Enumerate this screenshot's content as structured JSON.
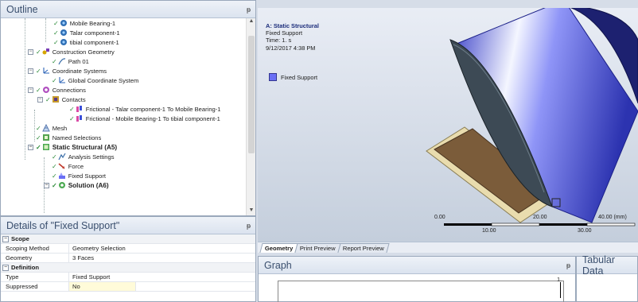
{
  "outline": {
    "title": "Outline",
    "pin": "ᵽ",
    "items": [
      {
        "label": "Mobile Bearing-1"
      },
      {
        "label": "Talar component-1"
      },
      {
        "label": "tibial component-1"
      },
      {
        "label": "Construction Geometry"
      },
      {
        "label": "Path 01"
      },
      {
        "label": "Coordinate Systems"
      },
      {
        "label": "Global Coordinate System"
      },
      {
        "label": "Connections"
      },
      {
        "label": "Contacts"
      },
      {
        "label": "Frictional - Talar component-1 To Mobile Bearing-1"
      },
      {
        "label": "Frictional - Mobile Bearing-1 To tibial component-1"
      },
      {
        "label": "Mesh"
      },
      {
        "label": "Named Selections"
      },
      {
        "label": "Static Structural (A5)"
      },
      {
        "label": "Analysis Settings"
      },
      {
        "label": "Force"
      },
      {
        "label": "Fixed Support"
      },
      {
        "label": "Solution (A6)"
      }
    ]
  },
  "details": {
    "title": "Details of \"Fixed Support\"",
    "pin": "ᵽ",
    "groups": [
      {
        "name": "Scope",
        "rows": [
          {
            "key": "Scoping Method",
            "value": "Geometry Selection"
          },
          {
            "key": "Geometry",
            "value": "3 Faces"
          }
        ]
      },
      {
        "name": "Definition",
        "rows": [
          {
            "key": "Type",
            "value": "Fixed Support"
          },
          {
            "key": "Suppressed",
            "value": "No"
          }
        ]
      }
    ]
  },
  "viewport": {
    "info_title": "A: Static Structural",
    "info_lines": [
      "Fixed Support",
      "Time: 1. s",
      "9/12/2017 4:38 PM"
    ],
    "legend_label": "Fixed Support",
    "scale": {
      "top_labels": [
        "0.00",
        "20.00",
        "40.00 (mm)"
      ],
      "bottom_labels": [
        "10.00",
        "30.00"
      ]
    }
  },
  "tabs": [
    "Geometry",
    "Print Preview",
    "Report Preview"
  ],
  "graph": {
    "title": "Graph",
    "max_label": "1."
  },
  "tabular": {
    "title": "Tabular Data"
  },
  "colors": {
    "fixed_support": "#6a6ff5",
    "panel_header": "#dbe3ef"
  }
}
